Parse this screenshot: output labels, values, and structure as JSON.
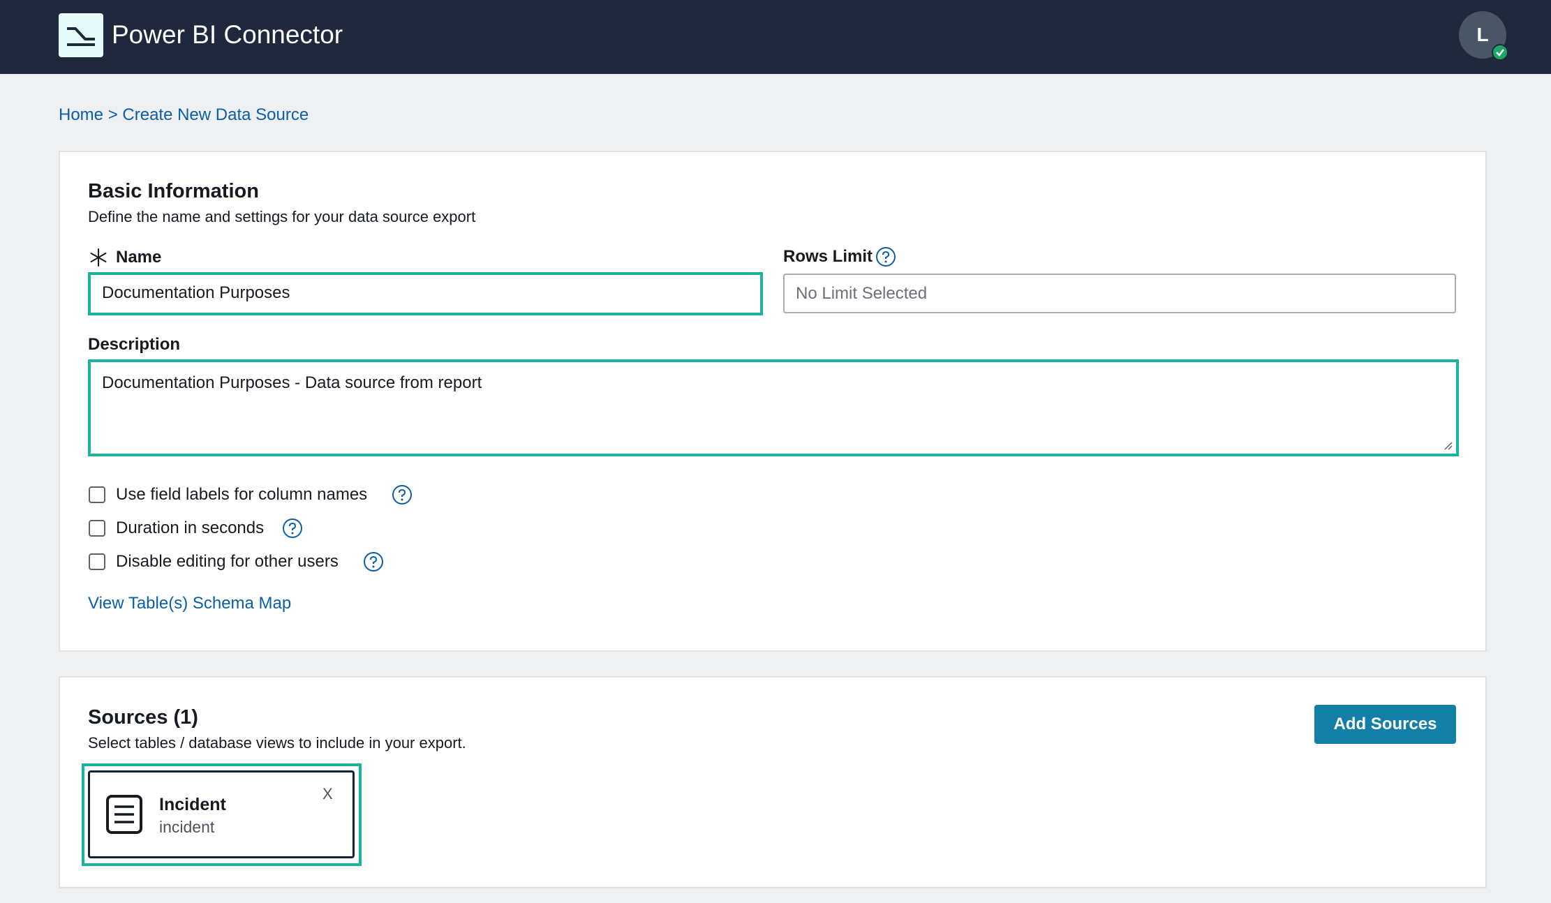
{
  "header": {
    "app_title": "Power BI Connector",
    "avatar_initial": "L"
  },
  "breadcrumb": {
    "home": "Home",
    "separator": ">",
    "current": "Create New Data Source"
  },
  "basic_info": {
    "title": "Basic Information",
    "subtitle": "Define the name and settings for your data source export",
    "name_label": "Name",
    "name_value": "Documentation Purposes",
    "rows_limit_label": "Rows Limit",
    "rows_limit_placeholder": "No Limit Selected",
    "description_label": "Description",
    "description_value": "Documentation Purposes - Data source from report",
    "options": [
      {
        "label": "Use field labels for column names",
        "checked": false
      },
      {
        "label": "Duration in seconds",
        "checked": false
      },
      {
        "label": "Disable editing for other users",
        "checked": false
      }
    ],
    "schema_link": "View Table(s) Schema Map"
  },
  "sources": {
    "title": "Sources (1)",
    "subtitle": "Select tables / database views to include in your export.",
    "add_button": "Add Sources",
    "items": [
      {
        "name": "Incident",
        "table": "incident",
        "remove_label": "X"
      }
    ]
  },
  "colors": {
    "header_bg": "#1f293b",
    "focus_ring": "#19b39f",
    "link": "#0b5ea8",
    "primary_button": "#137fa6",
    "status_online": "#1ca766"
  }
}
